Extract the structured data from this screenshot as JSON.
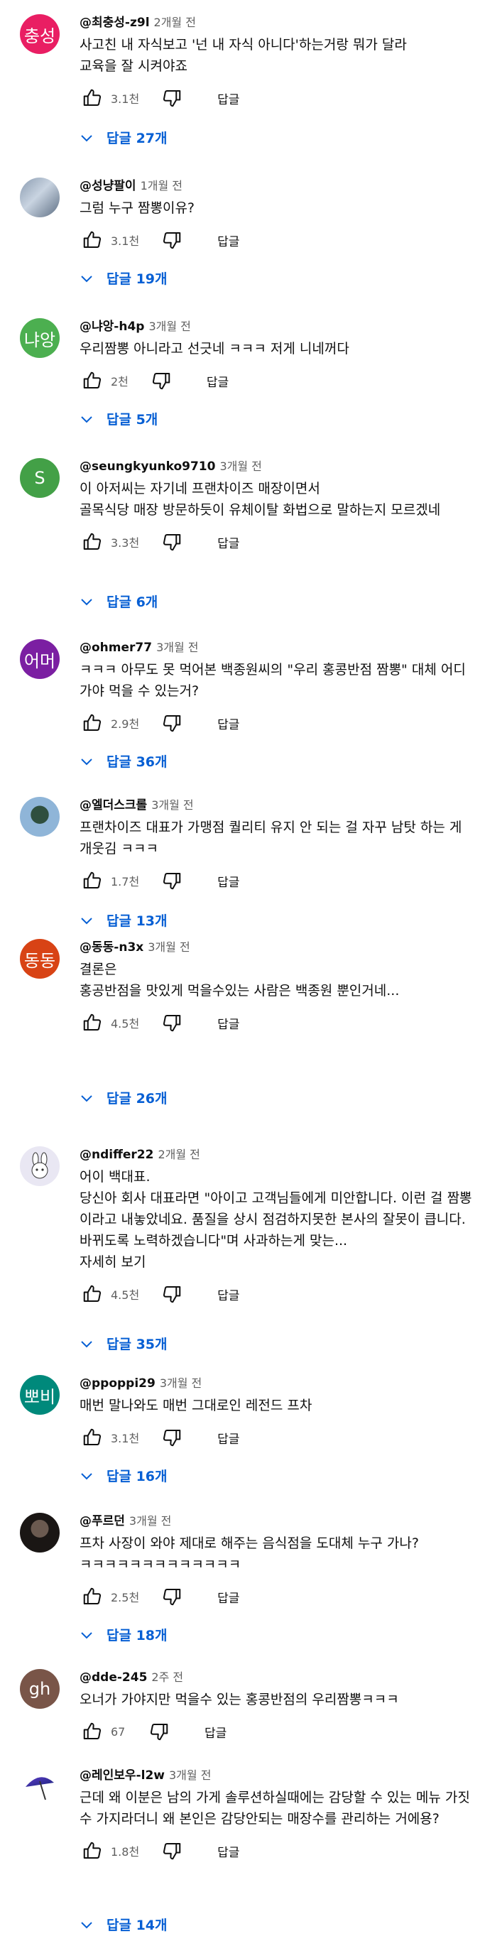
{
  "comments": [
    {
      "author": "@최충성-z9l",
      "time": "2개월 전",
      "avatar_text": "충성",
      "avatar_color": "#e91e63",
      "text": "사고친 내 자식보고 '넌 내 자식 아니다'하는거랑 뭐가 달라\n교육을 잘 시켜야죠",
      "likes": "3.1천",
      "reply_label": "답글",
      "replies": "답글 27개"
    },
    {
      "author": "@성냥팔이",
      "time": "1개월 전",
      "avatar_text": "",
      "avatar_color": "#9aa9bc",
      "text": "그럼 누구 짬뽕이유?",
      "likes": "3.1천",
      "reply_label": "답글",
      "replies": "답글 19개"
    },
    {
      "author": "@냐앙-h4p",
      "time": "3개월 전",
      "avatar_text": "냐앙",
      "avatar_color": "#4caf50",
      "text": "우리짬뽕 아니라고 선긋네 ㅋㅋㅋ  저게 니네꺼다",
      "likes": "2천",
      "reply_label": "답글",
      "replies": "답글 5개"
    },
    {
      "author": "@seungkyunko9710",
      "time": "3개월 전",
      "avatar_text": "S",
      "avatar_color": "#43a047",
      "text": "이 아저씨는 자기네 프랜차이즈 매장이면서\n골목식당 매장 방문하듯이 유체이탈 화법으로 말하는지 모르겠네",
      "likes": "3.3천",
      "reply_label": "답글",
      "replies": "답글 6개"
    },
    {
      "author": "@ohmer77",
      "time": "3개월 전",
      "avatar_text": "어머",
      "avatar_color": "#7b1fa2",
      "text": "ㅋㅋㅋ 아무도 못 먹어본 백종원씨의 \"우리 홍콩반점 짬뽕\" 대체 어디 가야 먹을 수 있는거?",
      "likes": "2.9천",
      "reply_label": "답글",
      "replies": "답글 36개"
    },
    {
      "author": "@엘더스크롤",
      "time": "3개월 전",
      "avatar_text": "",
      "avatar_color": "#8fb5d8",
      "text": "프랜차이즈 대표가 가맹점 퀄리티 유지 안 되는 걸 자꾸 남탓 하는 게 개웃김 ㅋㅋㅋ",
      "likes": "1.7천",
      "reply_label": "답글",
      "replies": "답글 13개"
    },
    {
      "author": "@동동-n3x",
      "time": "3개월 전",
      "avatar_text": "동동",
      "avatar_color": "#d84315",
      "text": "결론은\n홍공반점을 맛있게 먹을수있는 사람은 백종원 뿐인거네...",
      "likes": "4.5천",
      "reply_label": "답글",
      "replies": "답글 26개"
    },
    {
      "author": "@ndiffer22",
      "time": "2개월 전",
      "avatar_text": "",
      "avatar_color": "#e9e7f3",
      "text": "어이 백대표.\n당신아 회사 대표라면 \"아이고 고객님들에게 미안합니다. 이런 걸 짬뽕이라고 내놓았네요. 품질을 상시 점검하지못한 본사의 잘못이 큽니다. 바뀌도록 노력하겠습니다\"며 사과하는게 맞는...",
      "more": "자세히 보기",
      "likes": "4.5천",
      "reply_label": "답글",
      "replies": "답글 35개"
    },
    {
      "author": "@ppoppi29",
      "time": "3개월 전",
      "avatar_text": "뽀비",
      "avatar_color": "#00897b",
      "text": "매번 말나와도 매번 그대로인 레전드 프차",
      "likes": "3.1천",
      "reply_label": "답글",
      "replies": "답글 16개"
    },
    {
      "author": "@푸르던",
      "time": "3개월 전",
      "avatar_text": "",
      "avatar_color": "#1a1614",
      "text": "프차 사장이 와야 제대로 해주는 음식점을 도대체 누구 가나?\nㅋㅋㅋㅋㅋㅋㅋㅋㅋㅋㅋㅋㅋ",
      "likes": "2.5천",
      "reply_label": "답글",
      "replies": "답글 18개"
    },
    {
      "author": "@dde-245",
      "time": "2주 전",
      "avatar_text": "gh",
      "avatar_color": "#795548",
      "text": "오너가 가야지만 먹을수 있는 홍콩반점의 우리짬뽕ㅋㅋㅋ",
      "likes": "67",
      "reply_label": "답글",
      "replies": ""
    },
    {
      "author": "@레인보우-l2w",
      "time": "3개월 전",
      "avatar_text": "",
      "avatar_color": "#ffffff",
      "text": "근데 왜 이분은 남의 가게 솔루션하실때에는 감당할 수 있는 메뉴 가짓수 가지라더니 왜 본인은 감당안되는 매장수를 관리하는 거에용?",
      "likes": "1.8천",
      "reply_label": "답글",
      "replies": "답글 14개"
    }
  ]
}
